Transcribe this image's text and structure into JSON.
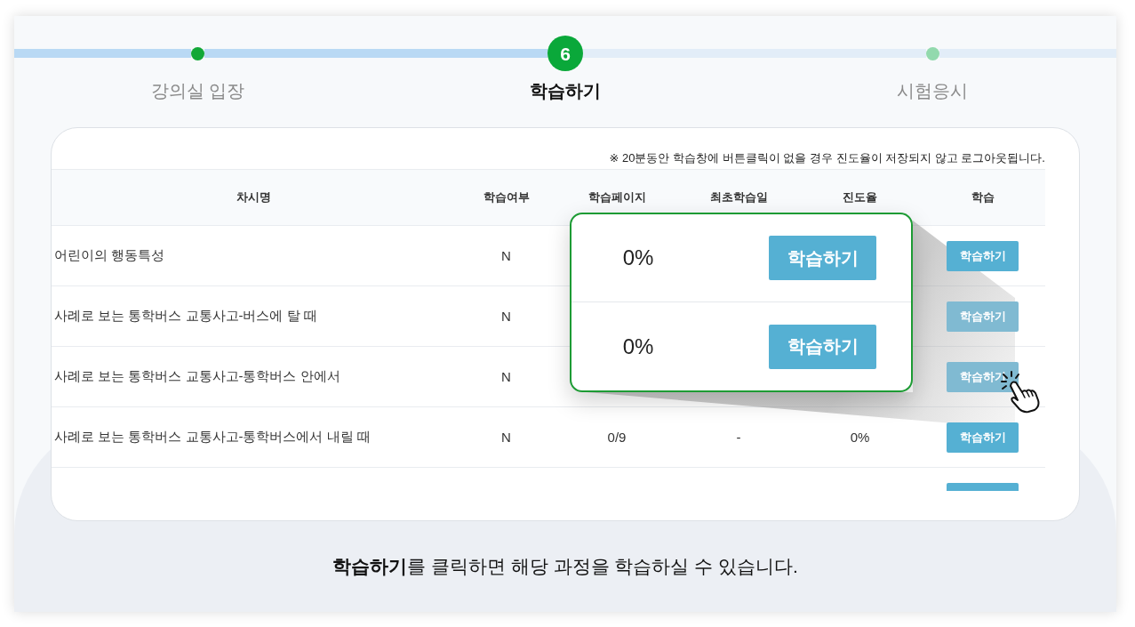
{
  "stepper": {
    "steps": [
      {
        "label": "강의실 입장",
        "completed": true,
        "selected": false
      },
      {
        "label": "학습하기",
        "completed": false,
        "selected": true,
        "number": "6"
      },
      {
        "label": "시험응시",
        "completed": false,
        "selected": false
      }
    ]
  },
  "card": {
    "notice": "※ 20분동안 학습창에 버튼클릭이 없을 경우 진도율이 저장되지 않고 로그아웃됩니다.",
    "table": {
      "columns": [
        "차시명",
        "학습여부",
        "학습페이지",
        "최초학습일",
        "진도율",
        "학습"
      ],
      "rows": [
        {
          "title": "어린이의 행동특성",
          "studied": "N",
          "button": "학습하기",
          "magnified": false
        },
        {
          "title": "사례로 보는 통학버스 교통사고-버스에 탈 때",
          "studied": "N",
          "button": "학습하기",
          "magnified": true
        },
        {
          "title": "사례로 보는 통학버스 교통사고-통학버스 안에서",
          "studied": "N",
          "button": "학습하기",
          "magnified": true
        },
        {
          "title": "사례로 보는 통학버스 교통사고-통학버스에서 내릴 때",
          "studied": "N",
          "pages": "0/9",
          "first_date": "-",
          "progress": "0%",
          "button": "학습하기",
          "magnified": false
        }
      ],
      "has_clipped_row": true
    },
    "callout": {
      "rows": [
        {
          "progress": "0%",
          "button": "학습하기"
        },
        {
          "progress": "0%",
          "button": "학습하기"
        }
      ]
    }
  },
  "caption": "**학습하기**를 클릭하면 해당 과정을 학습하실 수 있습니다."
}
